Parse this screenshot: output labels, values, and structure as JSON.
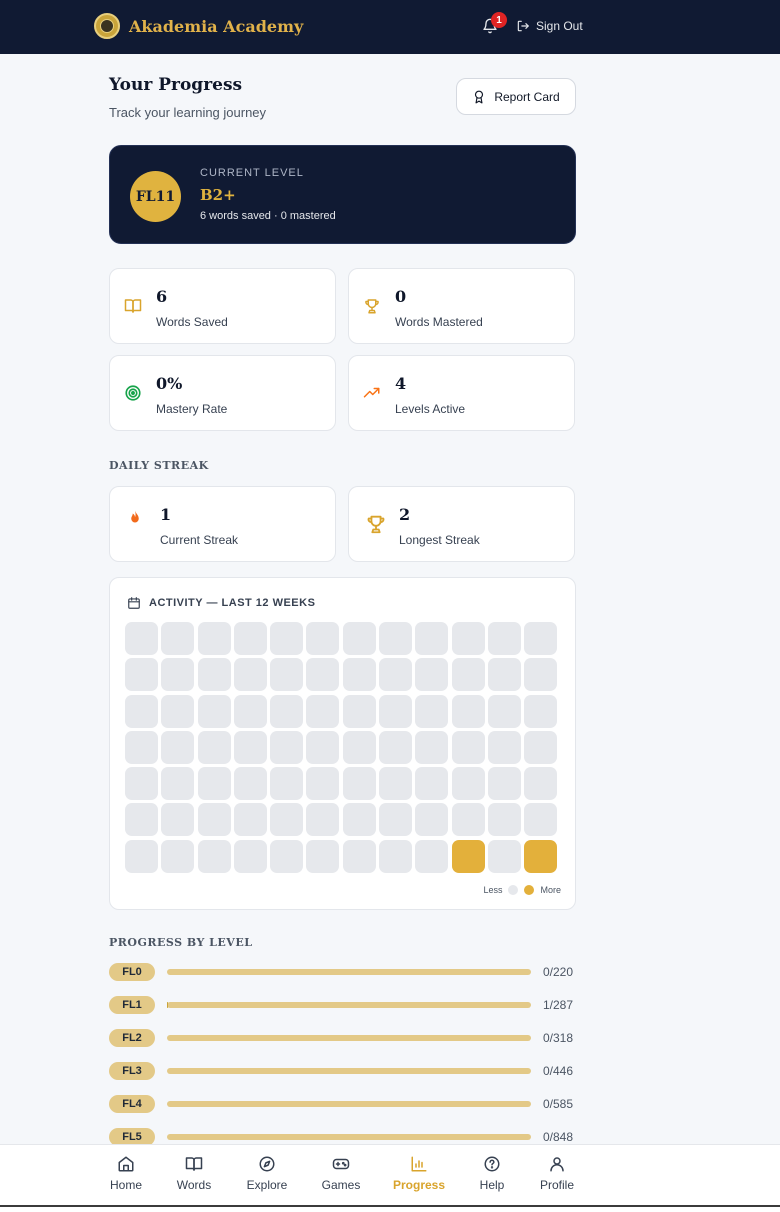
{
  "app": {
    "name": "Akademia Academy"
  },
  "header": {
    "notification_count": "1",
    "signout_label": "Sign Out"
  },
  "page": {
    "title": "Your Progress",
    "subtitle": "Track your learning journey",
    "report_card_label": "Report Card"
  },
  "level_card": {
    "label": "CURRENT LEVEL",
    "badge": "FL11",
    "level": "B2+",
    "meta": "6 words saved · 0 mastered"
  },
  "stats": [
    {
      "value": "6",
      "label": "Words Saved",
      "icon": "book-icon"
    },
    {
      "value": "0",
      "label": "Words Mastered",
      "icon": "trophy-icon"
    },
    {
      "value": "0%",
      "label": "Mastery Rate",
      "icon": "target-icon"
    },
    {
      "value": "4",
      "label": "Levels Active",
      "icon": "trending-up-icon"
    }
  ],
  "streak": {
    "heading": "DAILY STREAK",
    "current": {
      "value": "1",
      "label": "Current Streak",
      "icon": "flame-icon"
    },
    "longest": {
      "value": "2",
      "label": "Longest Streak",
      "icon": "trophy-icon"
    }
  },
  "activity": {
    "title": "ACTIVITY — LAST 12 WEEKS",
    "weeks": 12,
    "days": 7,
    "active_cells": [
      {
        "row": 6,
        "col": 9
      },
      {
        "row": 6,
        "col": 11
      }
    ],
    "legend_less": "Less",
    "legend_more": "More",
    "colors": {
      "empty": "#e6e8ec",
      "active": "#e3b03b"
    }
  },
  "levels": {
    "heading": "PROGRESS BY LEVEL",
    "rows": [
      {
        "label": "FL0",
        "count": "0/220",
        "progress": 0.0
      },
      {
        "label": "FL1",
        "count": "1/287",
        "progress": 0.0035
      },
      {
        "label": "FL2",
        "count": "0/318",
        "progress": 0.0
      },
      {
        "label": "FL3",
        "count": "0/446",
        "progress": 0.0
      },
      {
        "label": "FL4",
        "count": "0/585",
        "progress": 0.0
      },
      {
        "label": "FL5",
        "count": "0/848",
        "progress": 0.0
      }
    ]
  },
  "nav": {
    "items": [
      {
        "label": "Home",
        "icon": "home-icon"
      },
      {
        "label": "Words",
        "icon": "book-icon"
      },
      {
        "label": "Explore",
        "icon": "compass-icon"
      },
      {
        "label": "Games",
        "icon": "gamepad-icon"
      },
      {
        "label": "Progress",
        "icon": "bar-chart-icon",
        "active": true
      },
      {
        "label": "Help",
        "icon": "help-circle-icon"
      },
      {
        "label": "Profile",
        "icon": "user-icon"
      }
    ]
  },
  "colors": {
    "navy": "#101a33",
    "gold": "#e0b33f",
    "accent": "#d9a42c"
  }
}
